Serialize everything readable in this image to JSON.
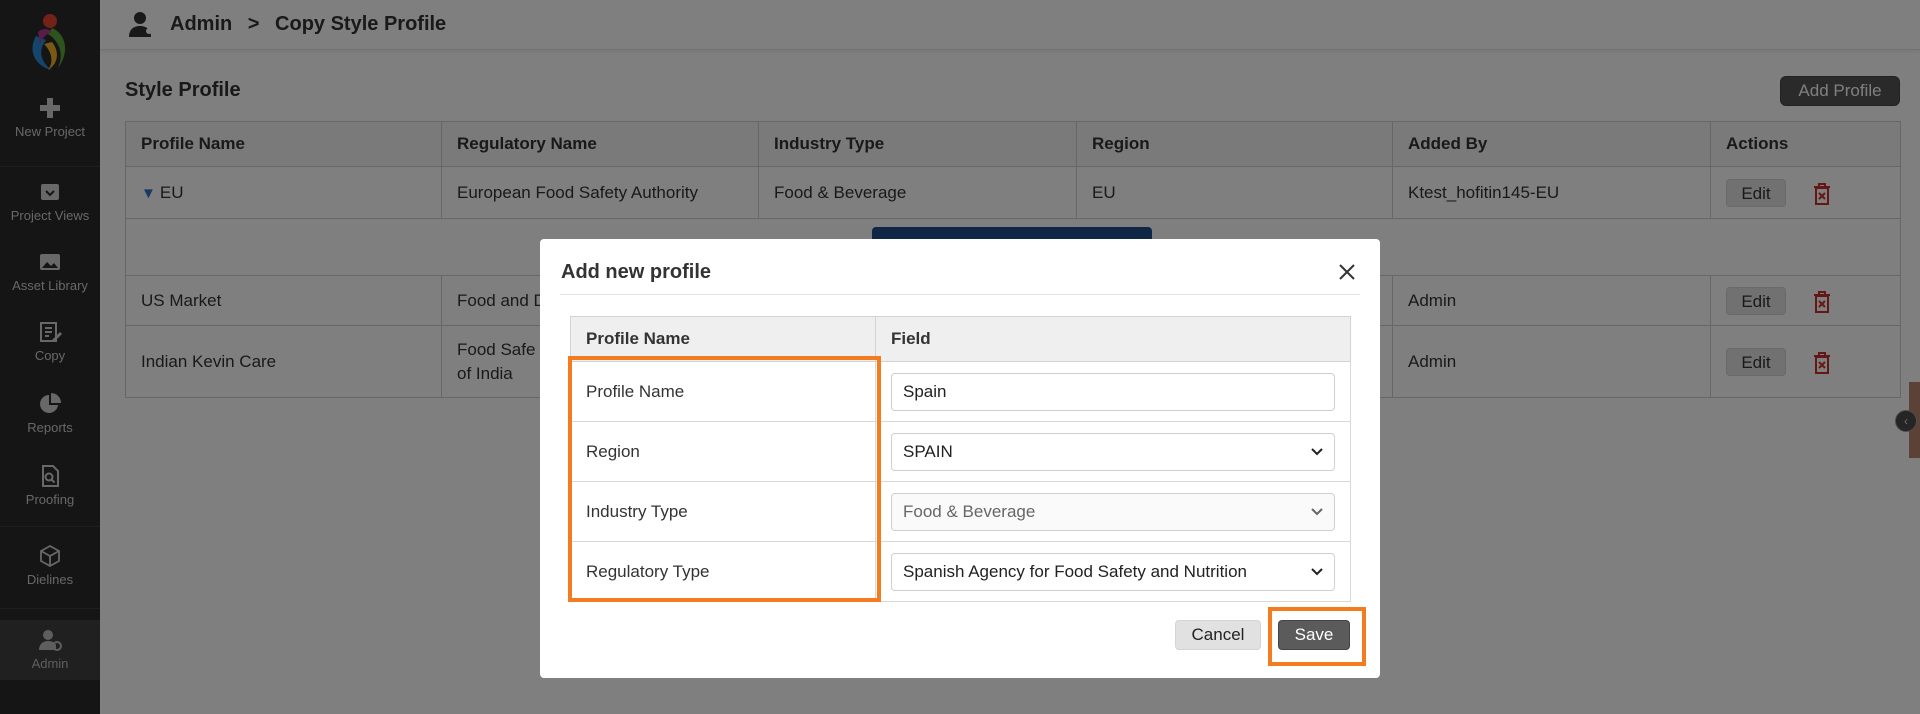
{
  "sidebar": {
    "items": [
      {
        "label": "New Project",
        "icon": "plus-icon"
      },
      {
        "label": "Project Views",
        "icon": "inbox-icon"
      },
      {
        "label": "Asset Library",
        "icon": "image-icon"
      },
      {
        "label": "Copy",
        "icon": "edit-icon"
      },
      {
        "label": "Reports",
        "icon": "pie-chart-icon"
      },
      {
        "label": "Proofing",
        "icon": "search-doc-icon"
      },
      {
        "label": "Dielines",
        "icon": "cube-icon"
      },
      {
        "label": "Admin",
        "icon": "user-gear-icon"
      }
    ]
  },
  "header": {
    "breadcrumb": [
      "Admin",
      ">",
      "Copy Style Profile"
    ]
  },
  "main": {
    "title": "Style Profile",
    "add_button": "Add Profile",
    "columns": [
      "Profile Name",
      "Regulatory Name",
      "Industry Type",
      "Region",
      "Added By",
      "Actions"
    ],
    "rows": [
      {
        "profile": "EU",
        "regulatory": "European Food Safety Authority",
        "industry": "Food & Beverage",
        "region": "EU",
        "added_by": "Ktest_hofitin145-EU",
        "action": "Edit"
      },
      {
        "profile": "US Market",
        "regulatory": "Food and D",
        "industry": "",
        "region": "",
        "added_by": "Admin",
        "action": "Edit"
      },
      {
        "profile": "Indian Kevin Care",
        "regulatory": "Food Safe\nof India",
        "industry": "",
        "region": "",
        "added_by": "Admin",
        "action": "Edit"
      }
    ]
  },
  "modal": {
    "title": "Add new profile",
    "columns": [
      "Profile Name",
      "Field"
    ],
    "fields": [
      {
        "label": "Profile Name",
        "value": "Spain",
        "type": "text"
      },
      {
        "label": "Region",
        "value": "SPAIN",
        "type": "select"
      },
      {
        "label": "Industry Type",
        "value": "Food & Beverage",
        "type": "select-disabled"
      },
      {
        "label": "Regulatory Type",
        "value": "Spanish Agency for Food Safety and Nutrition",
        "type": "select"
      }
    ],
    "cancel": "Cancel",
    "save": "Save"
  },
  "colors": {
    "highlight": "#f47c20",
    "sidebar_bg": "#2b2b2b",
    "expand_button": "#1f4f88"
  }
}
